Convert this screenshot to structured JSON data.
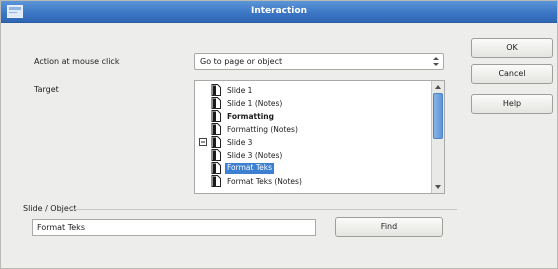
{
  "window": {
    "title": "Interaction"
  },
  "action": {
    "label": "Action at mouse click",
    "value": "Go to page or object"
  },
  "target": {
    "label": "Target",
    "items": [
      {
        "label": "Slide 1",
        "bold": false,
        "selected": false,
        "expander": false
      },
      {
        "label": "Slide 1 (Notes)",
        "bold": false,
        "selected": false,
        "expander": false
      },
      {
        "label": "Formatting",
        "bold": true,
        "selected": false,
        "expander": false
      },
      {
        "label": "Formatting (Notes)",
        "bold": false,
        "selected": false,
        "expander": false
      },
      {
        "label": "Slide 3",
        "bold": false,
        "selected": false,
        "expander": true
      },
      {
        "label": "Slide 3 (Notes)",
        "bold": false,
        "selected": false,
        "expander": false
      },
      {
        "label": "Format Teks",
        "bold": false,
        "selected": true,
        "expander": false
      },
      {
        "label": "Format Teks (Notes)",
        "bold": false,
        "selected": false,
        "expander": false
      }
    ]
  },
  "slide_object": {
    "label": "Slide / Object",
    "value": "Format Teks"
  },
  "buttons": {
    "ok": "OK",
    "cancel": "Cancel",
    "help": "Help",
    "find": "Find"
  }
}
